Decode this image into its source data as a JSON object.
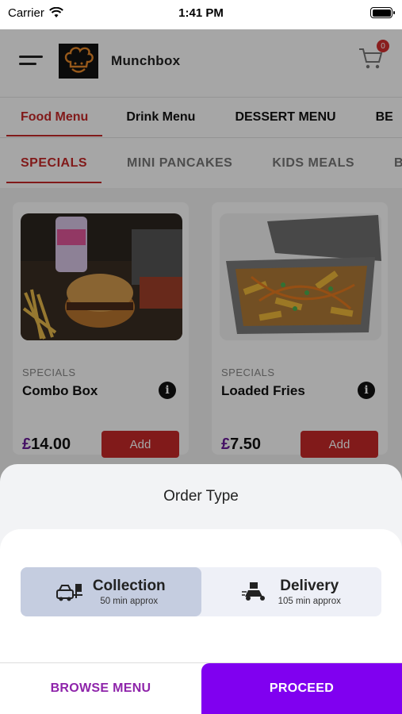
{
  "status_bar": {
    "carrier": "Carrier",
    "time": "1:41 PM"
  },
  "header": {
    "brand": "Munchbox",
    "cart_count": "0"
  },
  "menu_tabs": [
    "Food Menu",
    "Drink Menu",
    "DESSERT MENU",
    "BE"
  ],
  "category_tabs": [
    "SPECIALS",
    "MINI PANCAKES",
    "KIDS MEALS",
    "B"
  ],
  "products": [
    {
      "category": "SPECIALS",
      "name": "Combo Box",
      "currency": "£",
      "price": "14.00",
      "add_label": "Add"
    },
    {
      "category": "SPECIALS",
      "name": "Loaded Fries",
      "currency": "£",
      "price": "7.50",
      "add_label": "Add"
    }
  ],
  "order_sheet": {
    "title": "Order Type",
    "options": [
      {
        "title": "Collection",
        "subtitle": "50 min approx",
        "icon": "collection-icon",
        "selected": true
      },
      {
        "title": "Delivery",
        "subtitle": "105 min approx",
        "icon": "delivery-icon",
        "selected": false
      }
    ],
    "browse_label": "BROWSE MENU",
    "proceed_label": "PROCEED"
  },
  "colors": {
    "accent_red": "#c62828",
    "purple": "#8000f0",
    "selected_option": "#c5cde0"
  }
}
